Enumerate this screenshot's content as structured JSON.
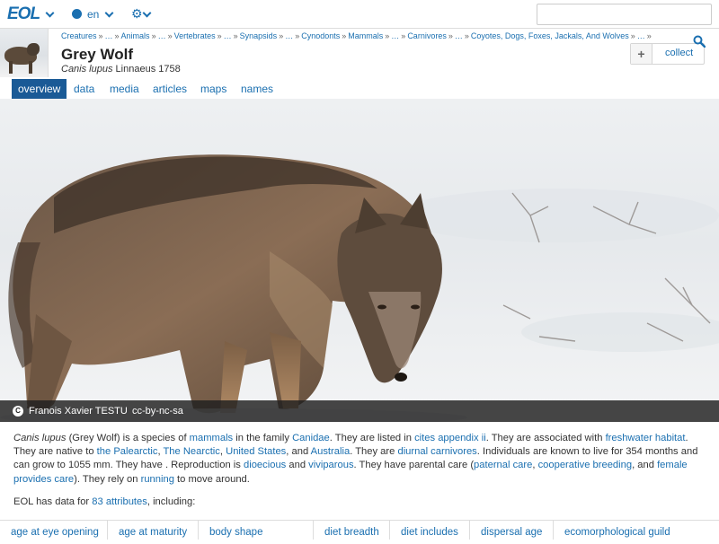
{
  "topbar": {
    "logo": "EOL",
    "language": "en"
  },
  "header": {
    "breadcrumb": [
      "Creatures",
      "…",
      "Animals",
      "…",
      "Vertebrates",
      "…",
      "Synapsids",
      "…",
      "Cynodonts",
      "Mammals",
      "…",
      "Carnivores",
      "…",
      "Coyotes, Dogs, Foxes, Jackals, And Wolves",
      "…"
    ],
    "title": "Grey Wolf",
    "scientific_name": "Canis lupus",
    "authority": "Linnaeus 1758",
    "collect_plus": "+",
    "collect_label": "collect"
  },
  "tabs": [
    "overview",
    "data",
    "media",
    "articles",
    "maps",
    "names"
  ],
  "active_tab": "overview",
  "hero": {
    "credit": "Franois Xavier TESTU",
    "license": "cc-by-nc-sa",
    "cc_symbol": "C"
  },
  "description": {
    "p1": "Canis lupus",
    "p2": " (Grey Wolf) is a species of ",
    "l1": "mammals",
    "p3": " in the family ",
    "l2": "Canidae",
    "p4": ". They are listed in ",
    "l3": "cites appendix ii",
    "p5": ". They are associated with ",
    "l4": "freshwater habitat",
    "p6": ". They are native to ",
    "l5": "the Palearctic",
    "p7": ", ",
    "l6": "The Nearctic",
    "p8": ", ",
    "l7": "United States",
    "p9": ", and ",
    "l8": "Australia",
    "p10": ". They are ",
    "l9": "diurnal carnivores",
    "p11": ". Individuals are known to live for 354 months and can grow to 1055 mm. They have . Reproduction is ",
    "l10": "dioecious",
    "p12": " and ",
    "l11": "viviparous",
    "p13": ". They have parental care (",
    "l12": "paternal care",
    "p14": ", ",
    "l13": "cooperative breeding",
    "p15": ", and ",
    "l14": "female provides care",
    "p16": "). They rely on ",
    "l15": "running",
    "p17": " to move around."
  },
  "attributes_summary": {
    "prefix": "EOL has data for ",
    "link": "83 attributes",
    "suffix": ", including:"
  },
  "attribute_tabs": [
    "age at eye opening",
    "age at maturity",
    "body shape",
    "diet breadth",
    "diet includes",
    "dispersal age",
    "ecomorphological guild"
  ],
  "colors": {
    "link": "#1a6fb0",
    "active_tab_bg": "#1a5a96",
    "caption_bg": "#1e1e1e"
  }
}
